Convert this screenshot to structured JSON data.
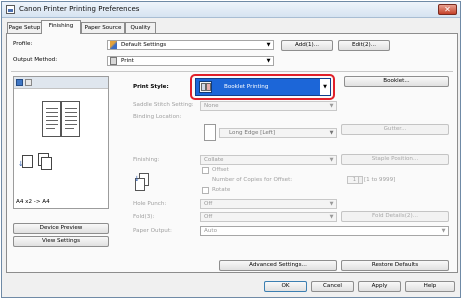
{
  "window": {
    "title": "Canon Printer Printing Preferences",
    "close_glyph": "✕"
  },
  "tabs": [
    {
      "label": "Page Setup"
    },
    {
      "label": "Finishing"
    },
    {
      "label": "Paper Source"
    },
    {
      "label": "Quality"
    }
  ],
  "profile": {
    "label": "Profile:",
    "value": "Default Settings",
    "add_label": "Add(1)...",
    "edit_label": "Edit(2)..."
  },
  "output": {
    "label": "Output Method:",
    "value": "Print"
  },
  "preview": {
    "paper_text": "A4 x2 -> A4",
    "device_preview_label": "Device Preview",
    "view_settings_label": "View Settings"
  },
  "print_style": {
    "label": "Print Style:",
    "value": "Booklet Printing",
    "booklet_button": "Booklet..."
  },
  "saddle_stitch": {
    "label": "Saddle Stitch Setting:",
    "value": "None"
  },
  "binding": {
    "label": "Binding Location:",
    "value": "Long Edge [Left]",
    "gutter_label": "Gutter..."
  },
  "finishing": {
    "label": "Finishing:",
    "value": "Collate",
    "staple_label": "Staple Position...",
    "offset_label": "Offset",
    "copies_label": "Number of Copies for Offset:",
    "copies_value": "1",
    "copies_range": "[1 to 9999]",
    "rotate_label": "Rotate"
  },
  "hole_punch": {
    "label": "Hole Punch:",
    "value": "Off"
  },
  "fold": {
    "label": "Fold(3):",
    "value": "Off",
    "details_label": "Fold Details(2)..."
  },
  "paper_output": {
    "label": "Paper Output:",
    "value": "Auto"
  },
  "bottom": {
    "advanced_label": "Advanced Settings...",
    "restore_label": "Restore Defaults",
    "ok_label": "OK",
    "cancel_label": "Cancel",
    "apply_label": "Apply",
    "help_label": "Help"
  },
  "icons": {
    "dropdown": "▼",
    "spin_up": "▲",
    "spin_down": "▼"
  }
}
